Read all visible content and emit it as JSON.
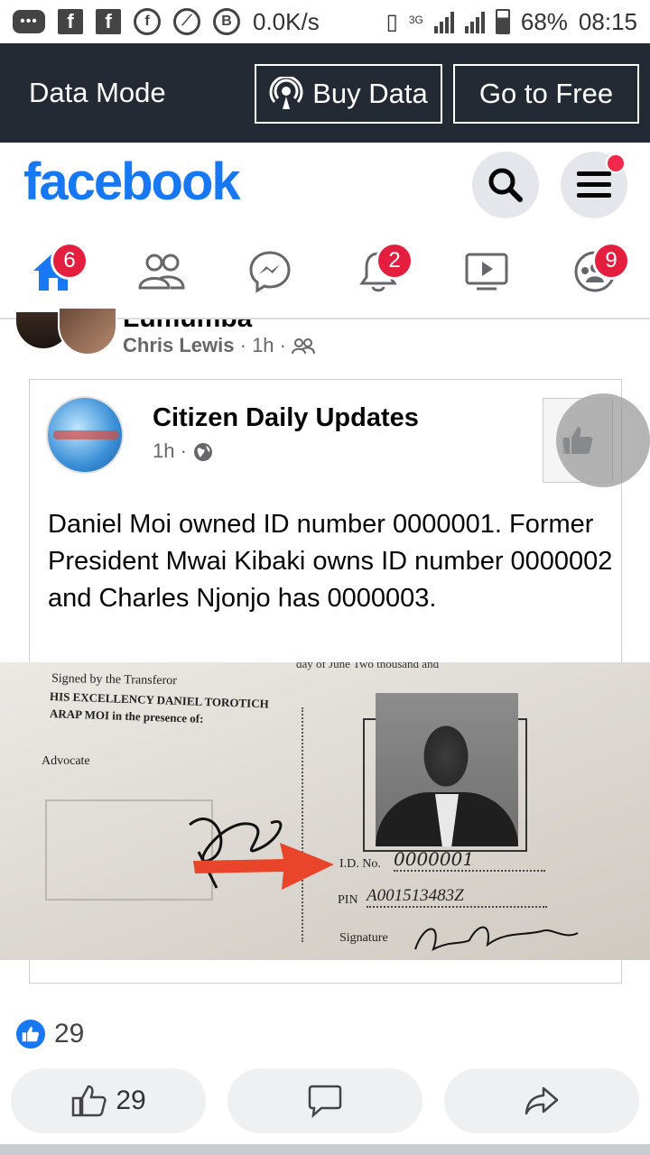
{
  "status_bar": {
    "net_speed": "0.0K/s",
    "network_type": "3G",
    "battery": "68%",
    "time": "08:15"
  },
  "data_bar": {
    "title": "Data Mode",
    "buy_label": "Buy Data",
    "free_label": "Go to Free"
  },
  "header": {
    "logo": "facebook"
  },
  "tabs": {
    "home_badge": "6",
    "notifications_badge": "2",
    "groups_badge": "9"
  },
  "prev_post": {
    "cut_title": "Lumumba",
    "author": "Chris Lewis",
    "time": "1h"
  },
  "shared_post": {
    "page_name": "Citizen Daily Updates",
    "time": "1h",
    "text": "Daniel Moi owned ID number 0000001. Former President Mwai Kibaki owns ID number 0000002 and Charles Njonjo has 0000003."
  },
  "photo": {
    "line_top": "day of June          Two thousand and",
    "signed_by": "Signed by the Transferor",
    "name_line1": "HIS EXCELLENCY DANIEL TOROTICH",
    "name_line2": "ARAP MOI in the presence of:",
    "advocate": "Advocate",
    "id_label": "I.D. No.",
    "id_value": "0000001",
    "pin_label": "PIN",
    "pin_value": "A001513483Z",
    "signature_label": "Signature"
  },
  "reactions": {
    "count": "29"
  },
  "actions": {
    "like_count": "29"
  },
  "colors": {
    "brand": "#1877f2",
    "badge": "#e41e3f",
    "data_bar": "#242a33"
  }
}
